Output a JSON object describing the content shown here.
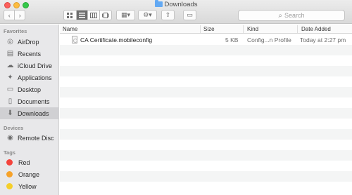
{
  "window": {
    "title": "Downloads",
    "search_placeholder": "Search"
  },
  "toolbar": {
    "back_icon": "‹",
    "forward_icon": "›",
    "view_icons": [
      "icon-view",
      "list-view",
      "column-view",
      "cover-flow-view"
    ],
    "arrange_icon": "▦▾",
    "action_icon": "⚙▾",
    "share_icon": "⇧",
    "tags_icon": "▭"
  },
  "sidebar": {
    "favorites_header": "Favorites",
    "favorites": [
      {
        "label": "AirDrop",
        "icon": "airdrop-icon",
        "glyph": "◎"
      },
      {
        "label": "Recents",
        "icon": "recents-icon",
        "glyph": "▤"
      },
      {
        "label": "iCloud Drive",
        "icon": "cloud-icon",
        "glyph": "☁"
      },
      {
        "label": "Applications",
        "icon": "applications-icon",
        "glyph": "✦"
      },
      {
        "label": "Desktop",
        "icon": "desktop-icon",
        "glyph": "▭"
      },
      {
        "label": "Documents",
        "icon": "documents-icon",
        "glyph": "▯"
      },
      {
        "label": "Downloads",
        "icon": "downloads-icon",
        "glyph": "⬇"
      }
    ],
    "devices_header": "Devices",
    "devices": [
      {
        "label": "Remote Disc",
        "icon": "disc-icon",
        "glyph": "◉"
      }
    ],
    "tags_header": "Tags",
    "tags": [
      {
        "label": "Red",
        "color": "#f4433c"
      },
      {
        "label": "Orange",
        "color": "#f6a22a"
      },
      {
        "label": "Yellow",
        "color": "#f5cf2a"
      }
    ]
  },
  "columns": {
    "name": "Name",
    "size": "Size",
    "kind": "Kind",
    "date_added": "Date Added"
  },
  "files": [
    {
      "name": "CA Certificate.mobileconfig",
      "size": "5 KB",
      "kind": "Config...n Profile",
      "date_added": "Today at 2:27 pm"
    }
  ]
}
